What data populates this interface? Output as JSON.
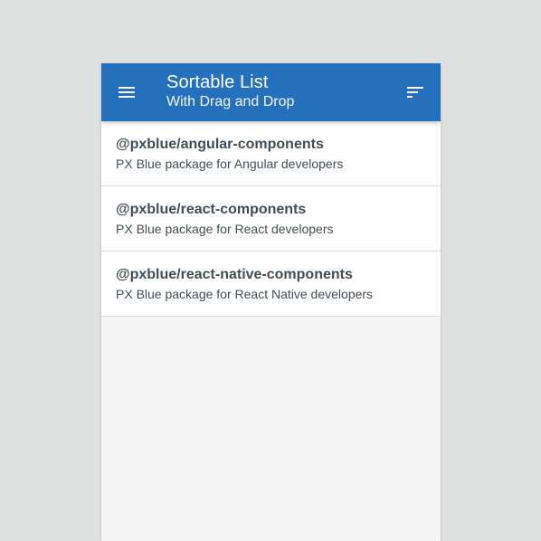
{
  "header": {
    "title": "Sortable List",
    "subtitle": "With Drag and Drop",
    "menu_icon": "menu-icon",
    "sort_icon": "sort-icon"
  },
  "list": {
    "items": [
      {
        "title": "@pxblue/angular-components",
        "subtitle": "PX Blue package for Angular developers"
      },
      {
        "title": "@pxblue/react-components",
        "subtitle": "PX Blue package for React developers"
      },
      {
        "title": "@pxblue/react-native-components",
        "subtitle": "PX Blue package for React Native developers"
      }
    ]
  },
  "colors": {
    "primary": "#2570bd",
    "background": "#f4f4f4",
    "page_background": "#dfe0e0",
    "text": "#424e54"
  }
}
